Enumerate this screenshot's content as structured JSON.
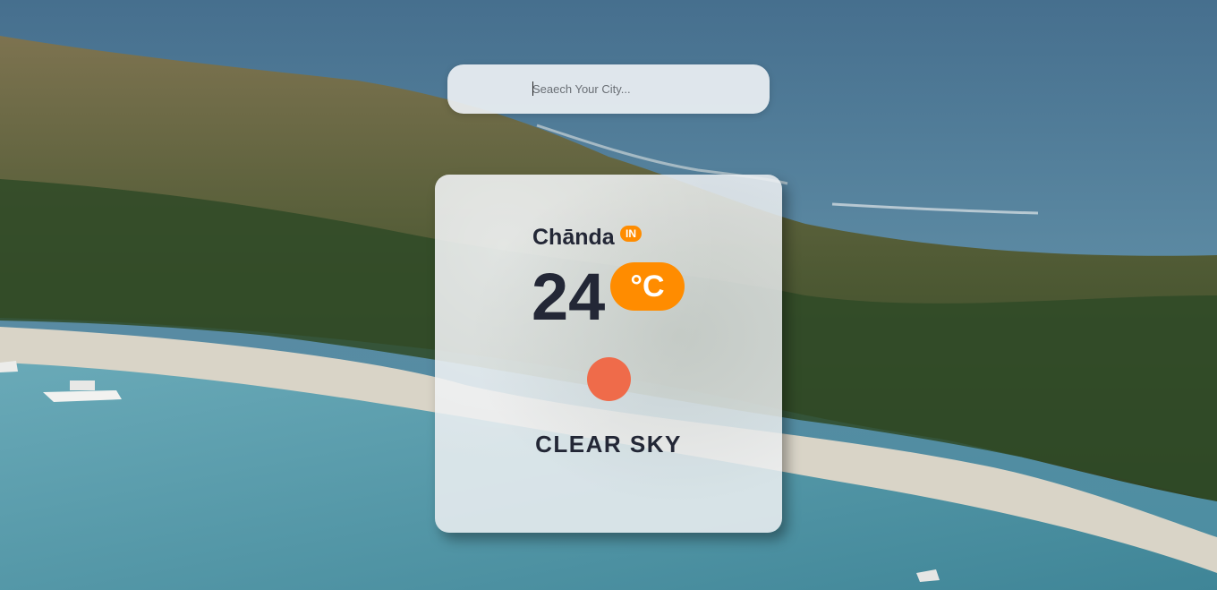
{
  "search": {
    "placeholder": "Seaech Your City...",
    "value": ""
  },
  "weather": {
    "city": "Chānda",
    "country": "IN",
    "temperature": "24",
    "unit": "°C",
    "description": "CLEAR SKY",
    "icon": "clear-sky-sun-icon"
  },
  "colors": {
    "accent": "#ff8c00",
    "sun": "#ef6b4a",
    "text": "#232736",
    "card": "#eef0f2"
  },
  "background": {
    "scene": "coastal-island-photo"
  }
}
